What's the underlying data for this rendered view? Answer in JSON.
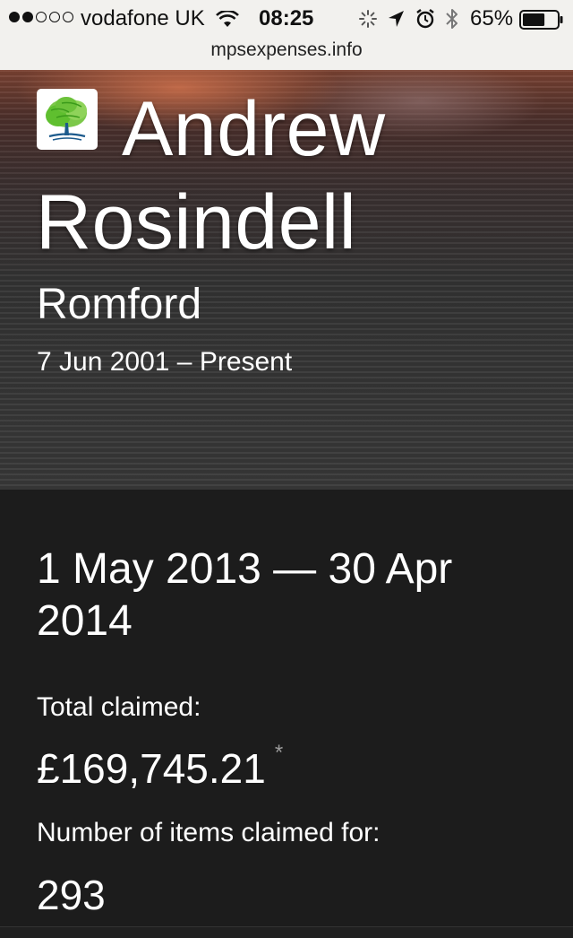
{
  "status_bar": {
    "signal": {
      "filled": 2,
      "total": 5
    },
    "carrier": "vodafone UK",
    "time": "08:25",
    "battery": "65%",
    "battery_level": 0.65,
    "icons": [
      "wifi-icon",
      "activity-icon",
      "location-arrow-icon",
      "alarm-icon",
      "bluetooth-icon",
      "battery-icon"
    ]
  },
  "browser": {
    "url": "mpsexpenses.info"
  },
  "mp": {
    "name": "Andrew Rosindell",
    "constituency": "Romford",
    "term": "7 Jun 2001 – Present",
    "party_logo": "conservative-tree-logo",
    "party_color": "#5fbf2f"
  },
  "expenses": {
    "period": "1 May 2013 — 30 Apr 2014",
    "total_label": "Total claimed:",
    "total_value": "£169,745.21",
    "footnote_marker": "*",
    "items_label": "Number of items claimed for:",
    "items_value": "293"
  }
}
